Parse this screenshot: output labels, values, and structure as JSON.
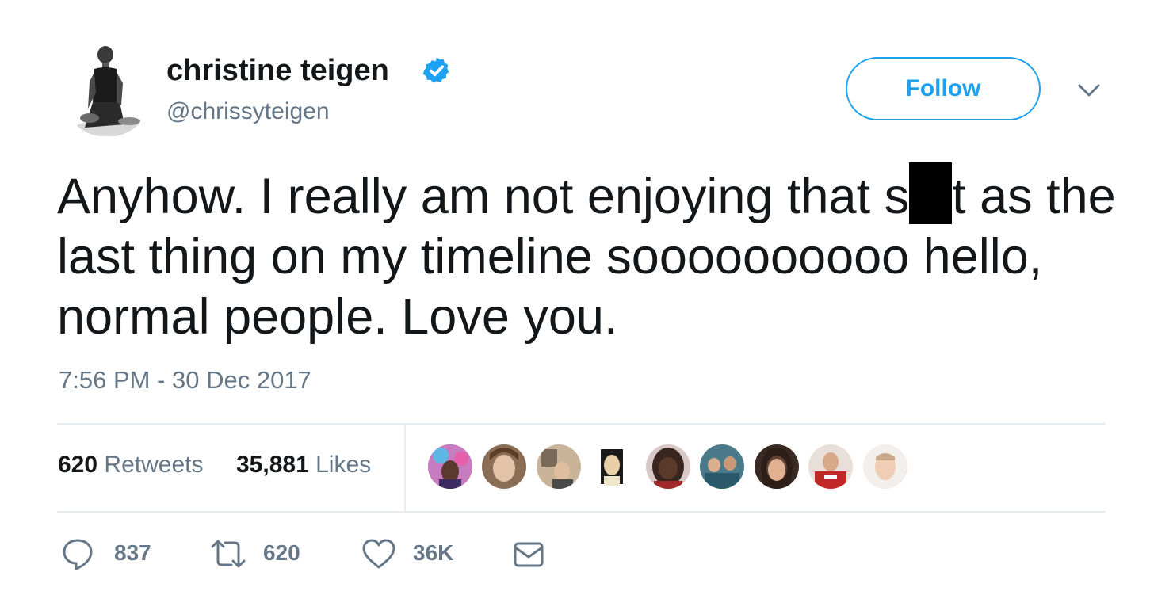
{
  "user": {
    "display_name": "christine teigen",
    "handle": "@chrissyteigen",
    "verified_icon": "verified-badge-icon",
    "avatar_icon": "profile-avatar"
  },
  "follow_button": {
    "label": "Follow"
  },
  "menu_caret": {
    "icon": "chevron-down-icon"
  },
  "tweet": {
    "text_part1": "Anyhow. I really am not enjoying that s",
    "text_part2": "t as the last thing on my timeline soooooooooo hello, normal people. Love you.",
    "timestamp": "7:56 PM - 30 Dec 2017"
  },
  "stats": {
    "retweets_count": "620",
    "retweets_label": "Retweets",
    "likes_count": "35,881",
    "likes_label": "Likes"
  },
  "likers": [
    {
      "name": "liker-avatar-1"
    },
    {
      "name": "liker-avatar-2"
    },
    {
      "name": "liker-avatar-3"
    },
    {
      "name": "liker-avatar-4"
    },
    {
      "name": "liker-avatar-5"
    },
    {
      "name": "liker-avatar-6"
    },
    {
      "name": "liker-avatar-7"
    },
    {
      "name": "liker-avatar-8"
    },
    {
      "name": "liker-avatar-9"
    }
  ],
  "actions": {
    "reply_count": "837",
    "retweet_count": "620",
    "like_count": "36K"
  },
  "colors": {
    "accent": "#1da1f2",
    "text_primary": "#14171a",
    "text_secondary": "#657786",
    "divider": "#e6ecf0"
  }
}
